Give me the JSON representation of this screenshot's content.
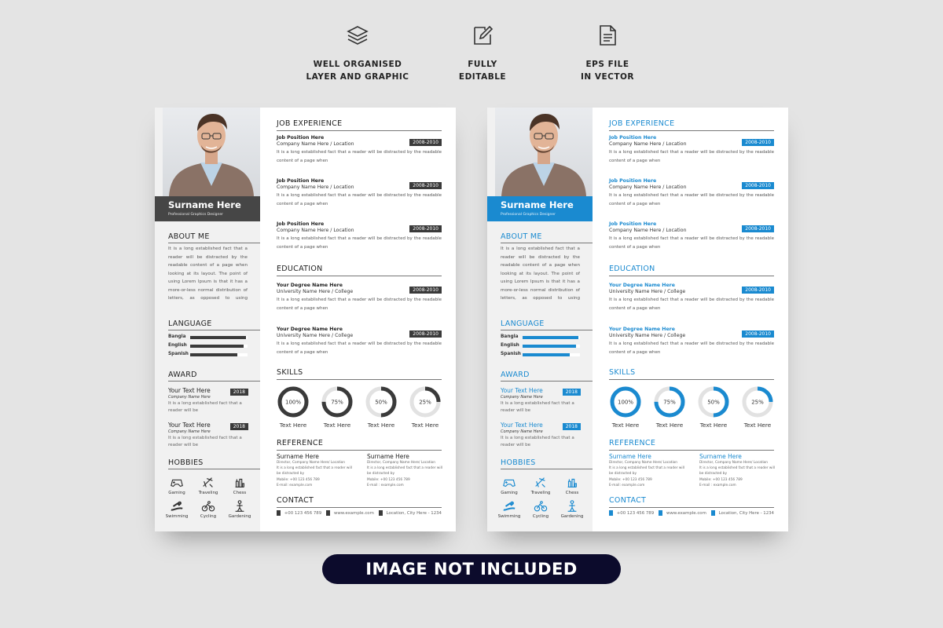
{
  "features": [
    {
      "icon": "layers-icon",
      "lines": [
        "WELL ORGANISED",
        "LAYER AND GRAPHIC"
      ]
    },
    {
      "icon": "edit-icon",
      "lines": [
        "FULLY",
        "EDITABLE"
      ]
    },
    {
      "icon": "file-icon",
      "lines": [
        "EPS FILE",
        "IN VECTOR"
      ]
    }
  ],
  "themes": [
    {
      "name": "dark",
      "accent": "#3a3a3a"
    },
    {
      "name": "blue",
      "accent": "#1a8ad0"
    }
  ],
  "resume": {
    "name": "Surname Here",
    "title": "Professional Graphics Designer",
    "about": {
      "heading": "ABOUT ME",
      "text": "It is a long established fact that a reader will be distracted by the readable content of a page when looking at its layout. The point of using Lorem Ipsum is that it has a more-or-less normal distribution of letters, as opposed to using"
    },
    "language": {
      "heading": "LANGUAGE",
      "items": [
        {
          "label": "Bangla",
          "level": 0.97
        },
        {
          "label": "English",
          "level": 0.93
        },
        {
          "label": "Spanish",
          "level": 0.82
        }
      ]
    },
    "award": {
      "heading": "AWARD",
      "items": [
        {
          "title": "Your Text Here",
          "company": "Company Name Here",
          "year": "2018",
          "text": "It is a long established fact that a reader will be"
        },
        {
          "title": "Your Text Here",
          "company": "Company Name Here",
          "year": "2018",
          "text": "It is a long established fact that a reader will be"
        }
      ]
    },
    "hobbies": {
      "heading": "HOBBIES",
      "items": [
        {
          "label": "Gaming",
          "icon": "gamepad-icon"
        },
        {
          "label": "Traveling",
          "icon": "airplane-icon"
        },
        {
          "label": "Chess",
          "icon": "chess-icon"
        },
        {
          "label": "Swimming",
          "icon": "swimmer-icon"
        },
        {
          "label": "Cycling",
          "icon": "cyclist-icon"
        },
        {
          "label": "Gardening",
          "icon": "gardener-icon"
        }
      ]
    },
    "experience": {
      "heading": "JOB EXPERIENCE",
      "items": [
        {
          "position": "Job Position Here",
          "company": "Company Name Here / Location",
          "year": "2008-2010",
          "text": "It is a long established fact that a reader will be distracted by the readable content of a page when"
        },
        {
          "position": "Job Position Here",
          "company": "Company Name Here / Location",
          "year": "2008-2010",
          "text": "It is a long established fact that a reader will be distracted by the readable content of a page when"
        },
        {
          "position": "Job Position Here",
          "company": "Company Name Here / Location",
          "year": "2008-2010",
          "text": "It is a long established fact that a reader will be distracted by the readable content of a page when"
        }
      ]
    },
    "education": {
      "heading": "EDUCATION",
      "items": [
        {
          "position": "Your Degree Name Here",
          "company": "University Name Here / College",
          "year": "2008-2010",
          "text": "It is a long established fact that a reader will be distracted by the readable content of a page when"
        },
        {
          "position": "Your Degree Name Here",
          "company": "University Name Here / College",
          "year": "2008-2010",
          "text": "It is a long established fact that a reader will be distracted by the readable content of a page when"
        }
      ]
    },
    "skills": {
      "heading": "SKILLS",
      "items": [
        {
          "percent": 100,
          "label": "100%",
          "name": "Text Here"
        },
        {
          "percent": 75,
          "label": "75%",
          "name": "Text Here"
        },
        {
          "percent": 50,
          "label": "50%",
          "name": "Text Here"
        },
        {
          "percent": 25,
          "label": "25%",
          "name": "Text Here"
        }
      ]
    },
    "reference": {
      "heading": "REFERENCE",
      "items": [
        {
          "name": "Surname Here",
          "role": "Director, Company Name Here/ Location",
          "text": "It is a long established fact that a reader will be distracted by",
          "mobile": "Mobile: +00 123 456 789",
          "email": "E-mail: example.com"
        },
        {
          "name": "Surname Here",
          "role": "Director, Company Name Here/ Location",
          "text": "It is a long established fact that a reader will be distracted by",
          "mobile": "Mobile: +00 123 456 789",
          "email": "E-mail : example.com"
        }
      ]
    },
    "contact": {
      "heading": "CONTACT",
      "phone": "+00 123 456 789",
      "website": "www.example.com",
      "location": "Location, City Here - 1234"
    }
  },
  "banner": "IMAGE NOT INCLUDED"
}
